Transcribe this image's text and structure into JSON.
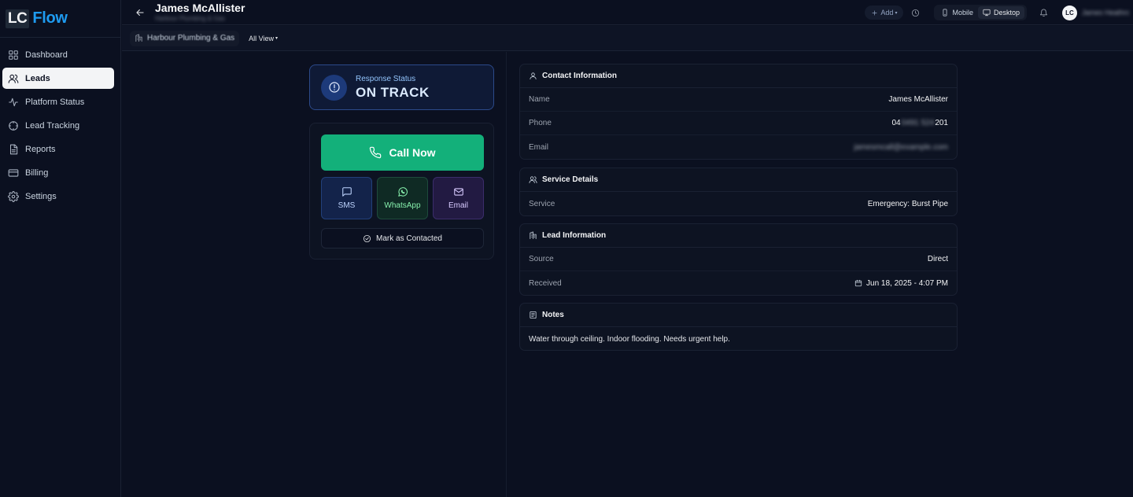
{
  "brand": {
    "badge": "LC",
    "name": "Flow"
  },
  "sidebar": {
    "items": [
      {
        "label": "Dashboard",
        "icon": "grid-icon"
      },
      {
        "label": "Leads",
        "icon": "users-icon",
        "active": true
      },
      {
        "label": "Platform Status",
        "icon": "activity-icon"
      },
      {
        "label": "Lead Tracking",
        "icon": "target-icon"
      },
      {
        "label": "Reports",
        "icon": "file-icon"
      },
      {
        "label": "Billing",
        "icon": "credit-card-icon"
      },
      {
        "label": "Settings",
        "icon": "gear-icon"
      }
    ]
  },
  "header": {
    "title": "James McAllister",
    "subtitle": "Harbour Plumbing & Gas",
    "add_label": "Add",
    "view_mobile": "Mobile",
    "view_desktop": "Desktop",
    "active_view": "Desktop",
    "avatar_initials": "LC",
    "user_name": "James Heathrow"
  },
  "subheader": {
    "company": "Harbour Plumbing & Gas",
    "view_label": "All View"
  },
  "status": {
    "label": "Response Status",
    "value": "ON TRACK"
  },
  "actions": {
    "call": "Call Now",
    "sms": "SMS",
    "whatsapp": "WhatsApp",
    "email": "Email",
    "mark_contacted": "Mark as Contacted"
  },
  "contact": {
    "title": "Contact Information",
    "name_label": "Name",
    "name_value": "James McAllister",
    "phone_label": "Phone",
    "phone_prefix": "04",
    "phone_hidden": "0491 524",
    "phone_suffix": "201",
    "email_label": "Email",
    "email_value": "jamesmcall@example.com"
  },
  "service": {
    "title": "Service Details",
    "service_label": "Service",
    "service_value": "Emergency: Burst Pipe"
  },
  "lead": {
    "title": "Lead Information",
    "source_label": "Source",
    "source_value": "Direct",
    "received_label": "Received",
    "received_value": "Jun 18, 2025 - 4:07 PM"
  },
  "notes": {
    "title": "Notes",
    "text": "Water through ceiling. Indoor flooding. Needs urgent help."
  },
  "colors": {
    "accent_blue": "#1e9bf0",
    "call_green": "#13b07a",
    "status_blue": "#2c4a8a"
  }
}
